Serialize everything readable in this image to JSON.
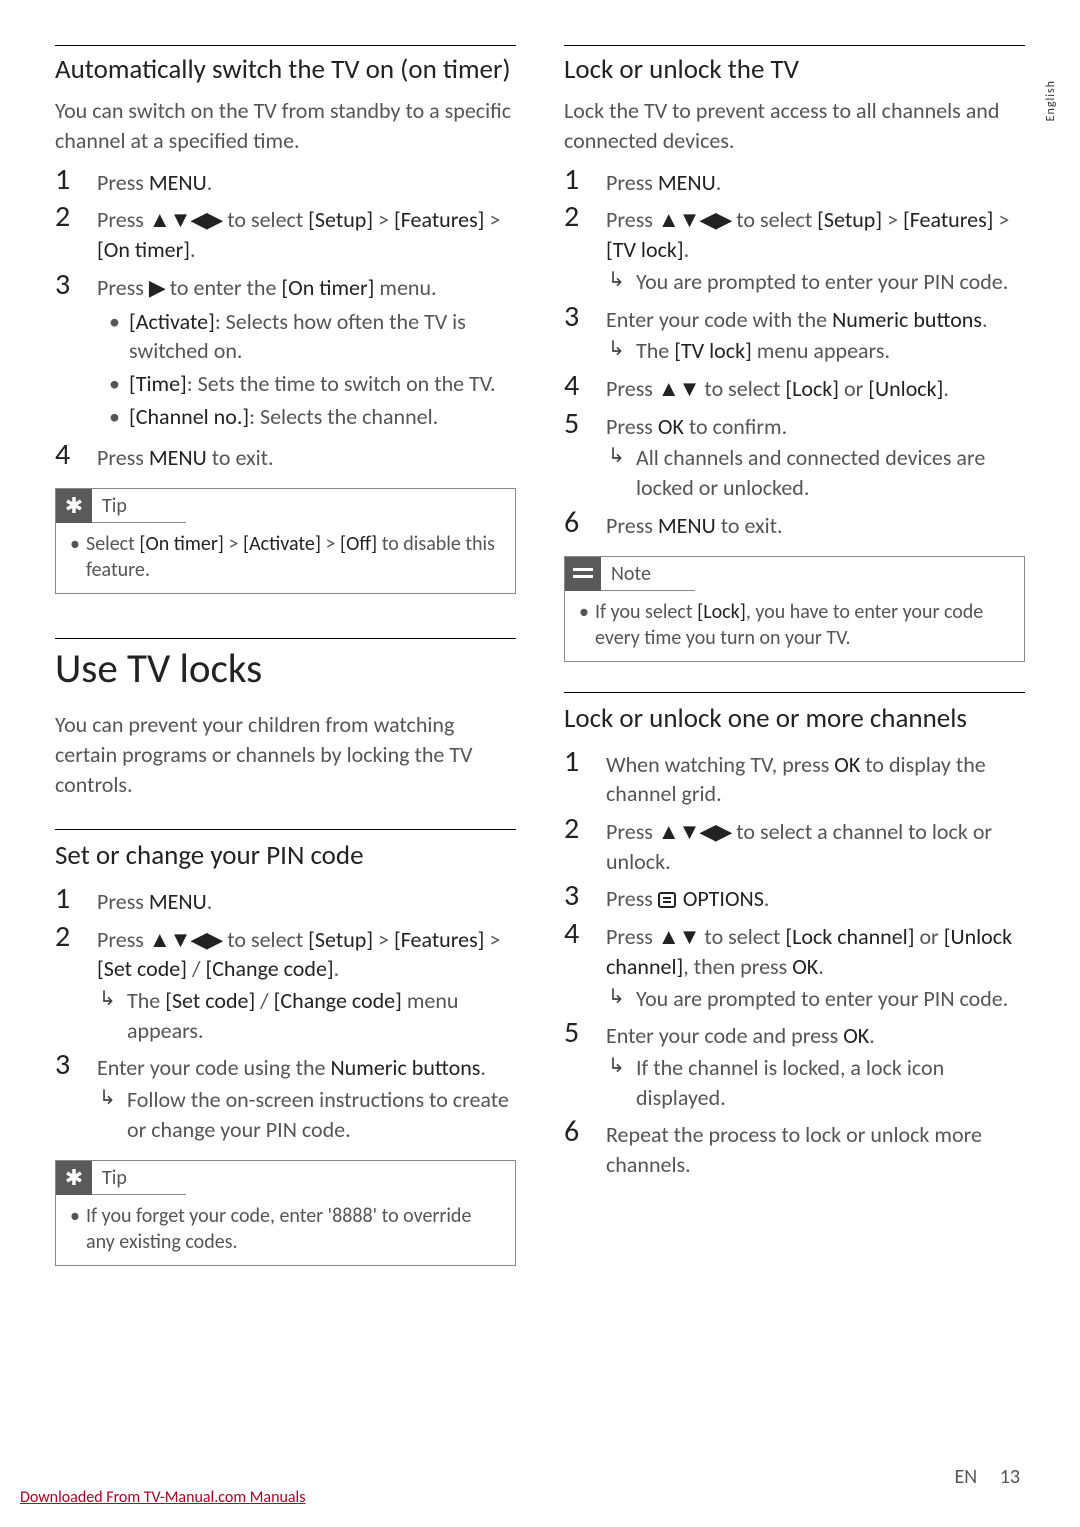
{
  "sideTab": "English",
  "footer": {
    "lang": "EN",
    "page": "13"
  },
  "downloadLink": "Downloaded From TV-Manual.com Manuals",
  "arrows4": "▲▼◀▶",
  "arrows2": "▲▼",
  "arrowR": "▶",
  "resultArrow": "↳",
  "left": {
    "sec1": {
      "title": "Automatically switch the TV on (on timer)",
      "intro": "You can switch on the TV from standby to a specific channel at a specified time.",
      "s1": {
        "a": "Press ",
        "b": "MENU",
        "c": "."
      },
      "s2": {
        "a": "Press ",
        "b": " to select ",
        "c": "[Setup]",
        "d": " > ",
        "e": "[Features]",
        "f": " > ",
        "g": "[On timer]",
        "h": "."
      },
      "s3": {
        "a": "Press ",
        "b": " to enter the ",
        "c": "[On timer]",
        "d": " menu."
      },
      "s3b1": {
        "a": "[Activate]",
        "b": ": Selects how often the TV is switched on."
      },
      "s3b2": {
        "a": "[Time]",
        "b": ": Sets the time to switch on the TV."
      },
      "s3b3": {
        "a": "[Channel no.]",
        "b": ": Selects the channel."
      },
      "s4": {
        "a": "Press ",
        "b": "MENU",
        "c": " to exit."
      },
      "tipLabel": "Tip",
      "tip": {
        "a": "Select ",
        "b": "[On timer]",
        "c": " > ",
        "d": "[Activate]",
        "e": " > ",
        "f": "[Off]",
        "g": " to disable this feature."
      }
    },
    "sec2": {
      "title": "Use TV locks",
      "intro": "You can prevent your children from watching certain programs or channels by locking the TV controls."
    },
    "sec3": {
      "title": "Set or change your PIN code",
      "s1": {
        "a": "Press ",
        "b": "MENU",
        "c": "."
      },
      "s2": {
        "a": "Press ",
        "b": " to select ",
        "c": "[Setup]",
        "d": " > ",
        "e": "[Features]",
        "f": " > ",
        "g": "[Set code]",
        "h": " / ",
        "i": "[Change code]",
        "j": "."
      },
      "s2r": {
        "a": "The ",
        "b": "[Set code]",
        "c": " / ",
        "d": "[Change code]",
        "e": " menu appears."
      },
      "s3": {
        "a": "Enter your code using the ",
        "b": "Numeric buttons",
        "c": "."
      },
      "s3r": "Follow the on-screen instructions to create or change your PIN code.",
      "tipLabel": "Tip",
      "tip": "If you forget your code, enter '8888' to override any existing codes."
    }
  },
  "right": {
    "sec1": {
      "title": "Lock or unlock the TV",
      "intro": "Lock the TV to prevent access to all channels and connected devices.",
      "s1": {
        "a": "Press ",
        "b": "MENU",
        "c": "."
      },
      "s2": {
        "a": "Press ",
        "b": " to select ",
        "c": "[Setup]",
        "d": " > ",
        "e": "[Features]",
        "f": " > ",
        "g": "[TV lock]",
        "h": "."
      },
      "s2r": "You are prompted to enter your PIN code.",
      "s3": {
        "a": "Enter your code with the ",
        "b": "Numeric buttons",
        "c": "."
      },
      "s3r": {
        "a": "The ",
        "b": "[TV lock]",
        "c": " menu appears."
      },
      "s4": {
        "a": "Press ",
        "b": " to select ",
        "c": "[Lock]",
        "d": " or ",
        "e": "[Unlock]",
        "f": "."
      },
      "s5": {
        "a": "Press ",
        "b": "OK",
        "c": " to confirm."
      },
      "s5r": "All channels and connected devices are locked or unlocked.",
      "s6": {
        "a": "Press ",
        "b": "MENU",
        "c": " to exit."
      },
      "noteLabel": "Note",
      "note": {
        "a": "If you select ",
        "b": "[Lock]",
        "c": ", you have to enter your code every time you turn on your TV."
      }
    },
    "sec2": {
      "title": "Lock or unlock one or more channels",
      "s1": {
        "a": "When watching TV, press ",
        "b": "OK",
        "c": " to display the channel grid."
      },
      "s2": {
        "a": "Press ",
        "b": " to select a channel to lock or unlock."
      },
      "s3": {
        "a": "Press ",
        "b": " OPTIONS",
        "c": "."
      },
      "s4": {
        "a": "Press ",
        "b": " to select ",
        "c": "[Lock channel]",
        "d": " or ",
        "e": "[Unlock channel]",
        "f": ", then press ",
        "g": "OK",
        "h": "."
      },
      "s4r": "You are prompted to enter your PIN code.",
      "s5": {
        "a": "Enter your code and press ",
        "b": "OK",
        "c": "."
      },
      "s5r": "If the channel is locked, a lock icon displayed.",
      "s6": "Repeat the process to lock or unlock more channels."
    }
  }
}
